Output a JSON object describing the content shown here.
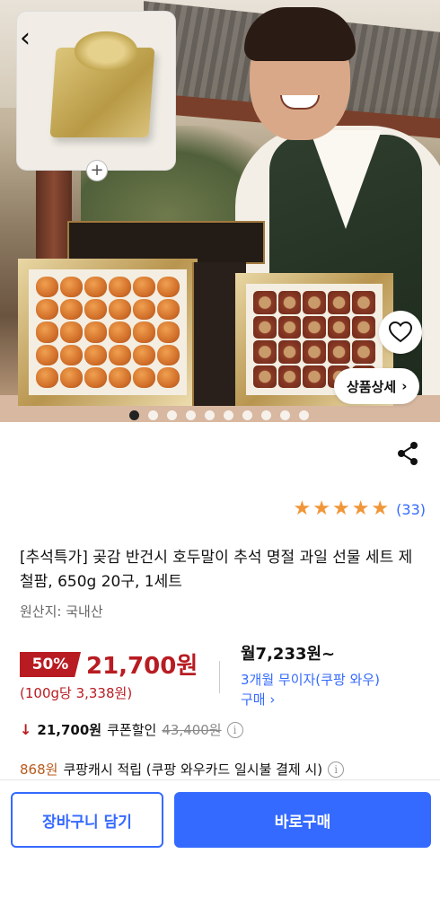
{
  "hero": {
    "thumbnail_plus": "+",
    "back_glyph": "‹",
    "detail_button_label": "상품상세",
    "detail_chevron": "›",
    "dots_total": 10,
    "dots_active_index": 0
  },
  "rating": {
    "stars": 5,
    "review_count": "(33)"
  },
  "product": {
    "title": "[추석특가] 곶감 반건시 호두말이 추석 명절 과일 선물 세트 제철팜, 650g 20구, 1세트",
    "origin": "원산지: 국내산"
  },
  "price": {
    "discount": "50%",
    "sale_price": "21,700원",
    "unit_price": "(100g당 3,338원)",
    "monthly": "월7,233원~",
    "installment": "3개월 무이자(쿠팡 와우) 구매 ›"
  },
  "coupon": {
    "arrow": "↓",
    "price": "21,700원",
    "label": "쿠폰할인",
    "original_price": "43,400원",
    "info": "i"
  },
  "cash": {
    "amount": "868원",
    "text": "쿠팡캐시 적립 (쿠팡 와우카드 일시불 결제 시)",
    "info": "i"
  },
  "actions": {
    "cart_label": "장바구니 담기",
    "buy_label": "바로구매"
  },
  "colors": {
    "accent": "#346aff",
    "sale": "#b81c22",
    "star": "#f19638",
    "cash": "#b8591a"
  }
}
